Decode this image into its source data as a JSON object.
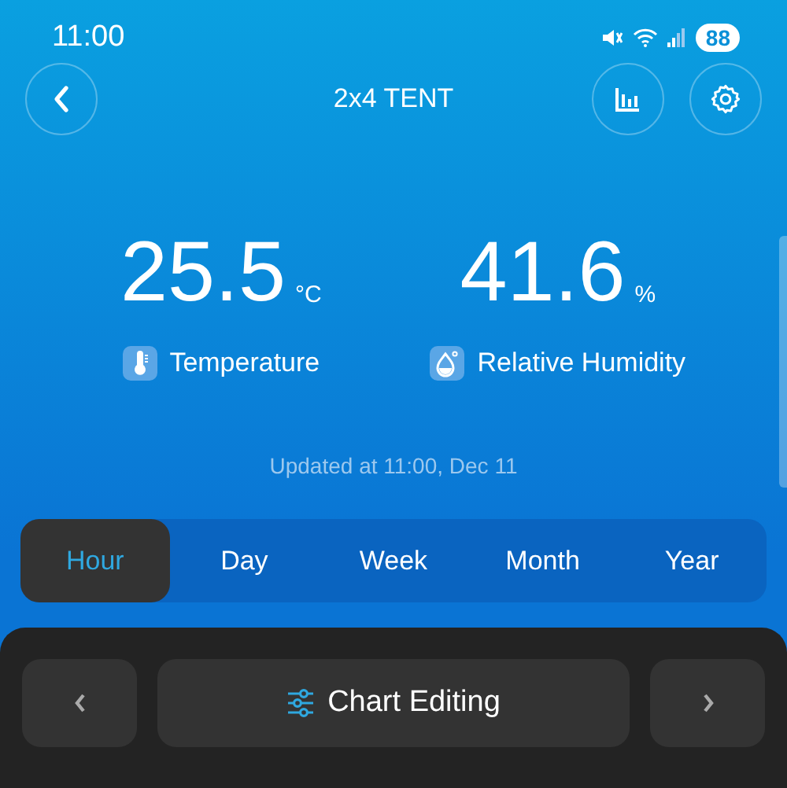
{
  "status_bar": {
    "time": "11:00",
    "battery": "88"
  },
  "header": {
    "title": "2x4 TENT"
  },
  "readings": [
    {
      "kind": "temperature",
      "value": "25.5",
      "unit": "°C",
      "label": "Temperature"
    },
    {
      "kind": "humidity",
      "value": "41.6",
      "unit": "%",
      "label": "Relative Humidity"
    }
  ],
  "updated": "Updated at 11:00, Dec 11",
  "tabs": [
    {
      "label": "Hour",
      "selected": true
    },
    {
      "label": "Day",
      "selected": false
    },
    {
      "label": "Week",
      "selected": false
    },
    {
      "label": "Month",
      "selected": false
    },
    {
      "label": "Year",
      "selected": false
    }
  ],
  "chart_editing": {
    "label": "Chart Editing"
  }
}
